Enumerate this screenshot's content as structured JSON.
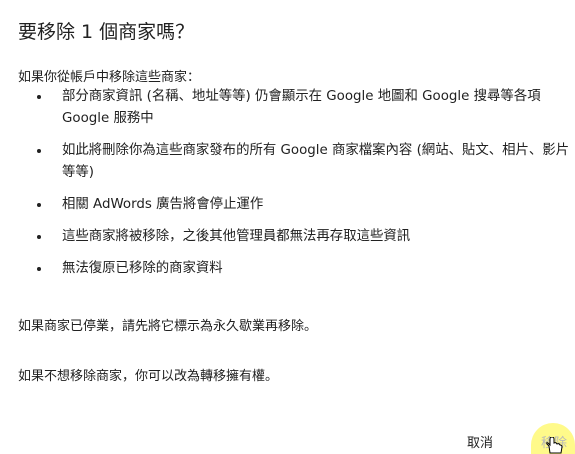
{
  "dialog": {
    "title": "要移除 1 個商家嗎？",
    "intro": "如果你從帳戶中移除這些商家：",
    "bullets": [
      "部分商家資訊 (名稱、地址等等) 仍會顯示在 Google 地圖和 Google 搜尋等各項 Google 服務中",
      "如此將刪除你為這些商家發布的所有 Google 商家檔案內容 (網站、貼文、相片、影片等等)",
      "相關 AdWords 廣告將會停止運作",
      "這些商家將被移除，之後其他管理員都無法再存取這些資訊",
      "無法復原已移除的商家資料"
    ],
    "closed_note": "如果商家已停業，請先將它標示為永久歇業再移除。",
    "transfer_note": "如果不想移除商家，你可以改為轉移擁有權。",
    "cancel_label": "取消",
    "remove_label": "移除",
    "highlight_color": "#fffa8a",
    "cursor_icon": "hand-pointer-icon"
  }
}
